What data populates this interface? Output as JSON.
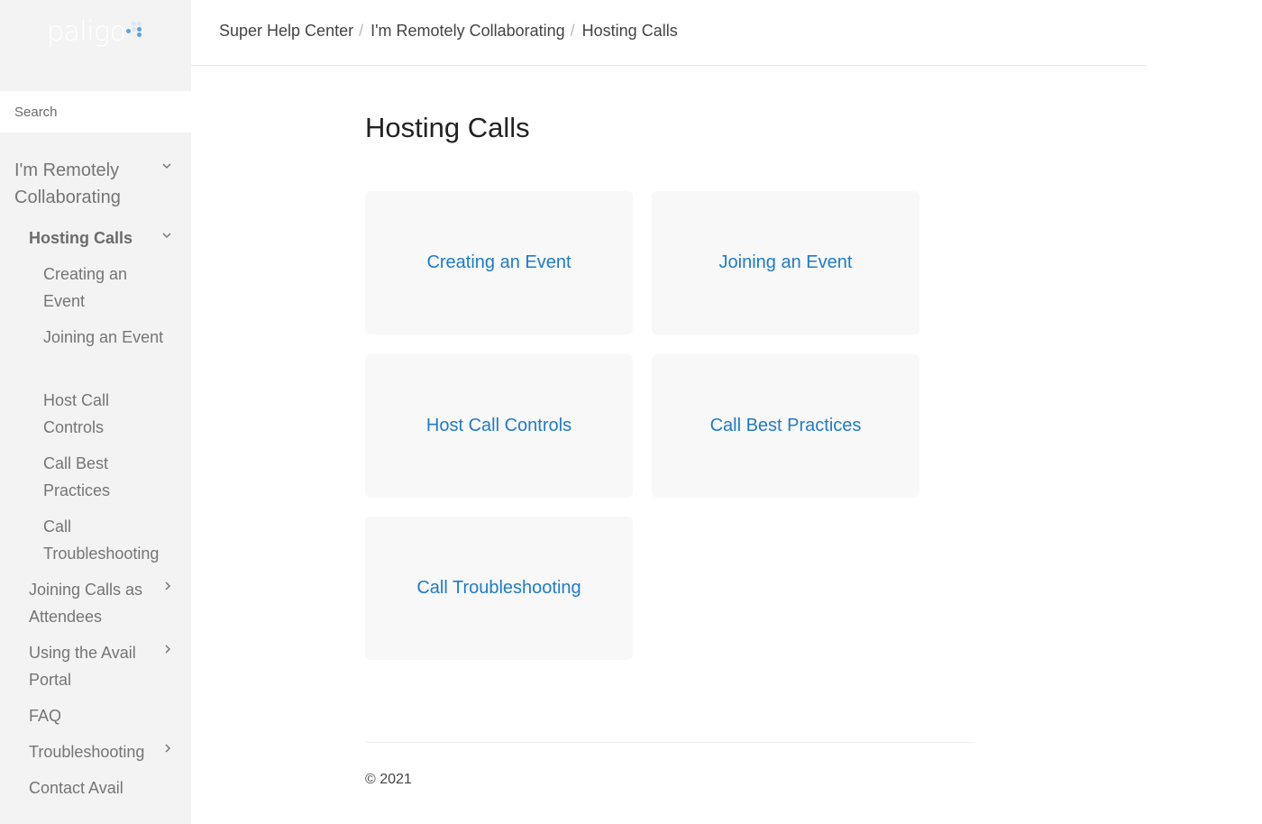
{
  "logo": {
    "text": "paligo"
  },
  "search": {
    "placeholder": "Search"
  },
  "sidebar": {
    "items": [
      {
        "label": "I'm Remotely Collaborating"
      },
      {
        "label": "Hosting Calls"
      },
      {
        "label": "Creating an Event"
      },
      {
        "label": "Joining an Event"
      },
      {
        "label": "Host Call Controls"
      },
      {
        "label": "Call Best Practices"
      },
      {
        "label": "Call Troubleshooting"
      },
      {
        "label": "Joining Calls as Attendees"
      },
      {
        "label": "Using the Avail Portal"
      },
      {
        "label": "FAQ"
      },
      {
        "label": "Troubleshooting"
      },
      {
        "label": "Contact Avail"
      }
    ]
  },
  "breadcrumb": {
    "items": [
      "Super Help Center",
      "I'm Remotely Collaborating",
      "Hosting Calls"
    ],
    "separator": "/"
  },
  "main": {
    "title": "Hosting Calls",
    "cards": [
      {
        "label": "Creating an Event"
      },
      {
        "label": "Joining an Event"
      },
      {
        "label": "Host Call Controls"
      },
      {
        "label": "Call Best Practices"
      },
      {
        "label": "Call Troubleshooting"
      }
    ]
  },
  "footer": {
    "copyright": "© 2021"
  },
  "colors": {
    "link": "#1e7bc9",
    "sidebar_bg": "#f3f3f3",
    "card_bg": "#f8f8f8"
  }
}
